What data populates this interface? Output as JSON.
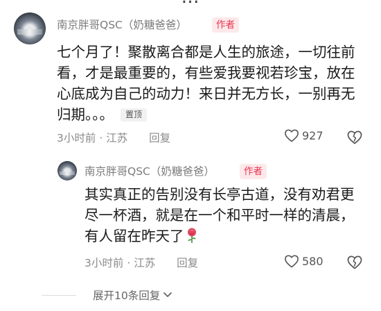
{
  "top_partial_text": "???",
  "comments": [
    {
      "username": "南京胖哥QSC（奶糖爸爸）",
      "author_tag": "作者",
      "lines": [
        "七个月了！聚散离合都是人生的旅途，一切往前",
        "看，才是最重要的，有些爱我要视若珍宝，放在",
        "心底成为自己的动力！来日并无方长，一别再无",
        "归期。。。"
      ],
      "pinned_label": "置顶",
      "time": "3小时前",
      "location": "江苏",
      "reply_label": "回复",
      "likes": "927"
    },
    {
      "username": "南京胖哥QSC（奶糖爸爸）",
      "author_tag": "作者",
      "lines": [
        "其实真正的告别没有长亭古道，没有劝君更",
        "尽一杯酒，就是在一个和平时一样的清晨，",
        "有人留在昨天了"
      ],
      "emoji": "rose",
      "time": "3小时前",
      "location": "江苏",
      "reply_label": "回复",
      "likes": "580"
    }
  ],
  "expand_label": "展开10条回复",
  "colors": {
    "author_tag_bg": "#fde8ea",
    "author_tag_text": "#e8364f",
    "meta": "#8a8a8a"
  }
}
